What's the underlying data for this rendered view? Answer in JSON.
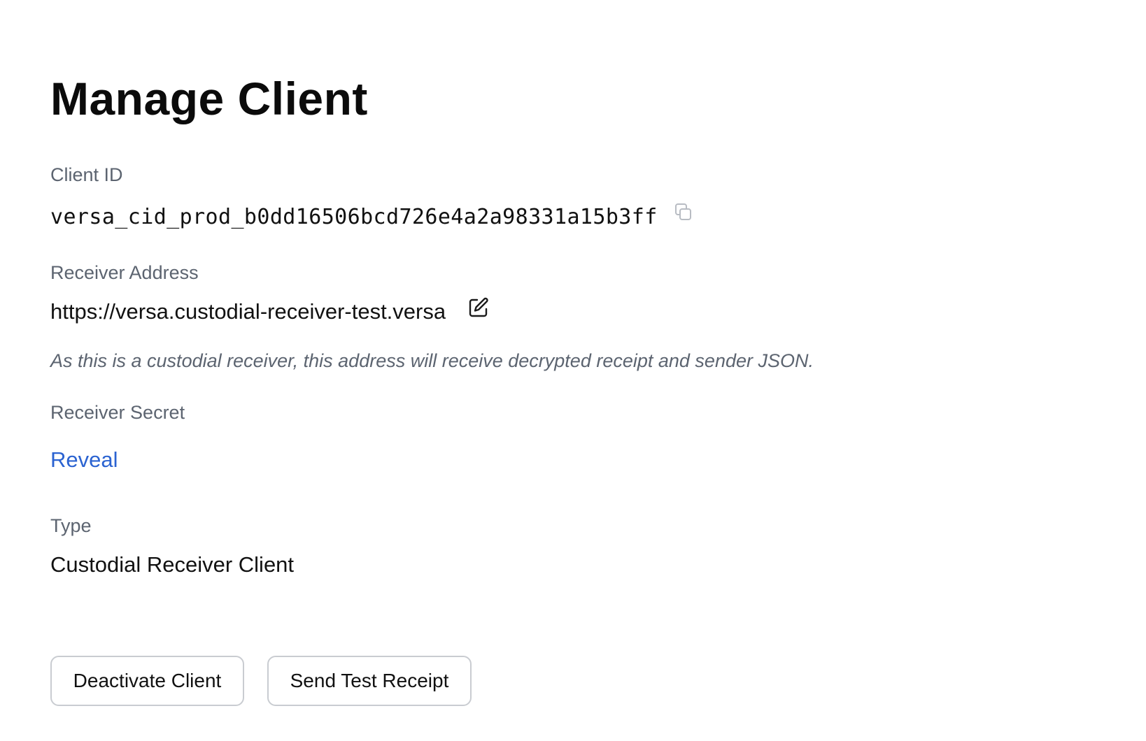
{
  "page": {
    "title": "Manage Client"
  },
  "client_id": {
    "label": "Client ID",
    "value": "versa_cid_prod_b0dd16506bcd726e4a2a98331a15b3ff",
    "copy_icon": "copy-icon"
  },
  "receiver_address": {
    "label": "Receiver Address",
    "value": "https://versa.custodial-receiver-test.versa",
    "edit_icon": "edit-icon",
    "note": "As this is a custodial receiver, this address will receive decrypted receipt and sender JSON."
  },
  "receiver_secret": {
    "label": "Receiver Secret",
    "reveal_label": "Reveal"
  },
  "type": {
    "label": "Type",
    "value": "Custodial Receiver Client"
  },
  "actions": {
    "deactivate_label": "Deactivate Client",
    "send_test_label": "Send Test Receipt"
  },
  "colors": {
    "link": "#2b63d1",
    "label": "#5c6470",
    "button_border": "#c9ccd1"
  }
}
